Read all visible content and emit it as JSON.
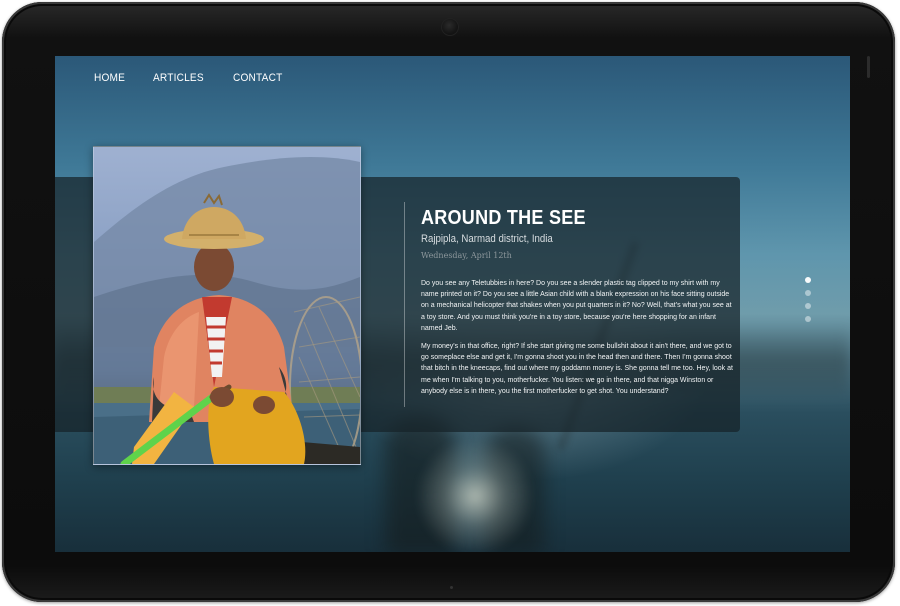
{
  "nav": {
    "items": [
      {
        "label": "HOME"
      },
      {
        "label": "ARTICLES"
      },
      {
        "label": "CONTACT"
      }
    ]
  },
  "article": {
    "title": "AROUND THE SEE",
    "location": "Rajpipla, Narmad district, India",
    "date": "Wednesday, April 12th",
    "paragraphs": [
      "Do you see any Teletubbies in here? Do you see a slender plastic tag clipped to my shirt with my name printed on it? Do you see a little Asian child with a blank expression on his face sitting outside on a mechanical helicopter that shakes when you put quarters in it? No? Well, that's what you see at a toy store. And you must think you're in a toy store, because you're here shopping for an infant named Jeb.",
      "My money's in that office, right? If she start giving me some bullshit about it ain't there, and we got to go someplace else and get it, I'm gonna shoot you in the head then and there. Then I'm gonna shoot that bitch in the kneecaps, find out where my goddamn money is. She gonna tell me too. Hey, look at me when I'm talking to you, motherfucker. You listen: we go in there, and that nigga Winston or anybody else is in there, you the first motherfucker to get shot. You understand?"
    ]
  },
  "slider": {
    "count": 4,
    "active_index": 0
  },
  "colors": {
    "panel": "#16222880",
    "text": "#ffffff",
    "date": "#8d979c"
  }
}
